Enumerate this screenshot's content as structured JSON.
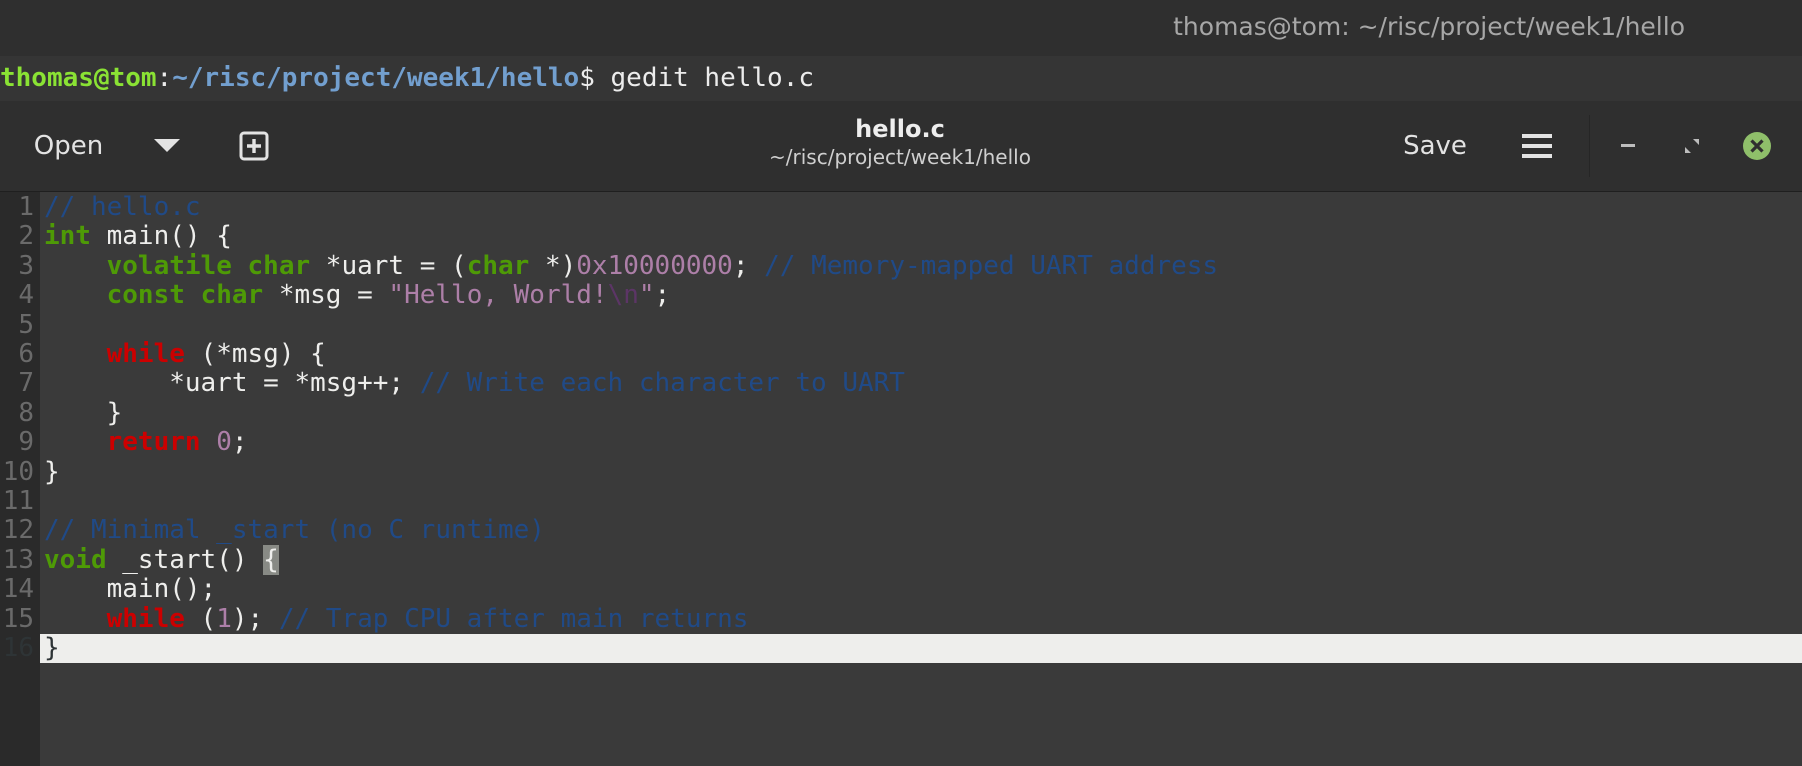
{
  "terminal": {
    "title": "thomas@tom: ~/risc/project/week1/hello",
    "prompt_user": "thomas@tom",
    "prompt_colon": ":",
    "prompt_path": "~/risc/project/week1/hello",
    "prompt_dollar": "$ ",
    "command": "gedit hello.c"
  },
  "gedit": {
    "open_label": "Open",
    "save_label": "Save",
    "title": "hello.c",
    "subtitle": "~/risc/project/week1/hello",
    "icons": {
      "open_dropdown": "chevron-down-icon",
      "new_tab": "new-tab-icon",
      "menu": "hamburger-menu-icon",
      "minimize": "minimize-icon",
      "maximize": "maximize-icon",
      "close": "close-icon"
    }
  },
  "editor": {
    "current_line": 16,
    "lines": [
      {
        "n": "1",
        "tokens": [
          {
            "t": "// hello.c",
            "c": "cmt"
          }
        ]
      },
      {
        "n": "2",
        "tokens": [
          {
            "t": "int",
            "c": "kw"
          },
          {
            "t": " main() {"
          }
        ]
      },
      {
        "n": "3",
        "tokens": [
          {
            "t": "    "
          },
          {
            "t": "volatile",
            "c": "kw"
          },
          {
            "t": " "
          },
          {
            "t": "char",
            "c": "kw"
          },
          {
            "t": " *uart = ("
          },
          {
            "t": "char",
            "c": "kw"
          },
          {
            "t": " *)"
          },
          {
            "t": "0x10000000",
            "c": "num"
          },
          {
            "t": "; "
          },
          {
            "t": "// Memory-mapped UART address",
            "c": "cmt"
          }
        ]
      },
      {
        "n": "4",
        "tokens": [
          {
            "t": "    "
          },
          {
            "t": "const",
            "c": "kw"
          },
          {
            "t": " "
          },
          {
            "t": "char",
            "c": "kw"
          },
          {
            "t": " *msg = "
          },
          {
            "t": "\"Hello, World!",
            "c": "str"
          },
          {
            "t": "\\n",
            "c": "esc"
          },
          {
            "t": "\"",
            "c": "str"
          },
          {
            "t": ";"
          }
        ]
      },
      {
        "n": "5",
        "tokens": []
      },
      {
        "n": "6",
        "tokens": [
          {
            "t": "    "
          },
          {
            "t": "while",
            "c": "ctl"
          },
          {
            "t": " (*msg) {"
          }
        ]
      },
      {
        "n": "7",
        "tokens": [
          {
            "t": "        *uart = *msg++; "
          },
          {
            "t": "// Write each character to UART",
            "c": "cmt"
          }
        ]
      },
      {
        "n": "8",
        "tokens": [
          {
            "t": "    }"
          }
        ]
      },
      {
        "n": "9",
        "tokens": [
          {
            "t": "    "
          },
          {
            "t": "return",
            "c": "ctl"
          },
          {
            "t": " "
          },
          {
            "t": "0",
            "c": "num"
          },
          {
            "t": ";"
          }
        ]
      },
      {
        "n": "10",
        "tokens": [
          {
            "t": "}"
          }
        ]
      },
      {
        "n": "11",
        "tokens": []
      },
      {
        "n": "12",
        "tokens": [
          {
            "t": "// Minimal _start (no C runtime)",
            "c": "cmt"
          }
        ]
      },
      {
        "n": "13",
        "tokens": [
          {
            "t": "void",
            "c": "kw"
          },
          {
            "t": " _start() "
          },
          {
            "t": "{",
            "c": "brace"
          }
        ]
      },
      {
        "n": "14",
        "tokens": [
          {
            "t": "    main();"
          }
        ]
      },
      {
        "n": "15",
        "tokens": [
          {
            "t": "    "
          },
          {
            "t": "while",
            "c": "ctl"
          },
          {
            "t": " ("
          },
          {
            "t": "1",
            "c": "num"
          },
          {
            "t": "); "
          },
          {
            "t": "// Trap CPU after main returns",
            "c": "cmt"
          }
        ]
      },
      {
        "n": "16",
        "tokens": [
          {
            "t": "}",
            "c": "brace"
          }
        ]
      }
    ]
  }
}
